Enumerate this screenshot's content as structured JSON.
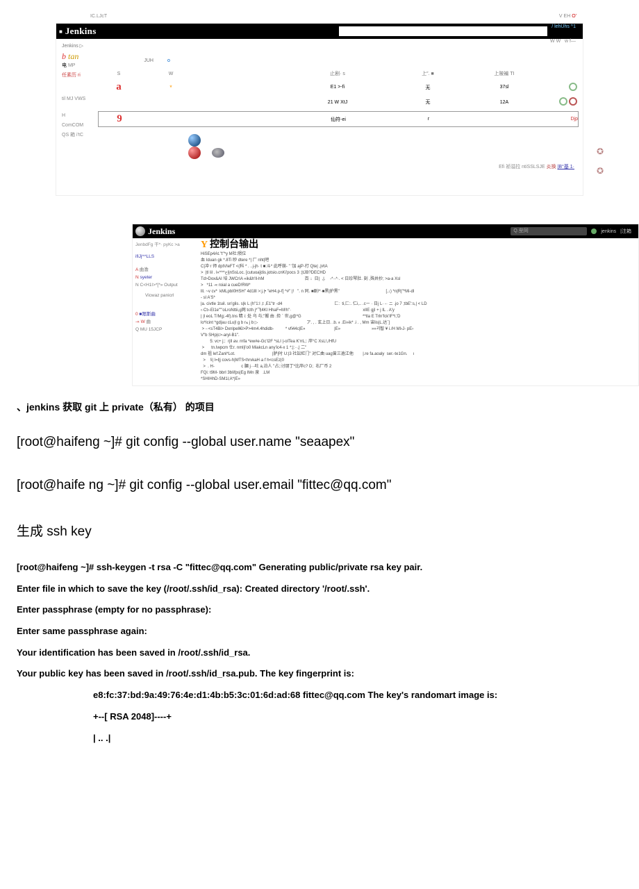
{
  "toprow": {
    "left": "IC.LJcT",
    "right_a": "V EH ",
    "right_b": "O'"
  },
  "dash": {
    "brand": "Jenkins",
    "login": "/ lehUhs\n^1",
    "scale": "W W   w f—",
    "crumb": "Jenkins  ▷",
    "side": {
      "tan_b": "b ",
      "tan_t": "tan",
      "l1_icon": "电",
      "l1": "MP",
      "l2_pre": "z",
      "l2": "任素历 ri",
      "sep": "",
      "q1": "til MJ VWS",
      "q2": "H ComCOM QS 箱 i'tC"
    },
    "tabs": {
      "jun": "JUH",
      "plus": "o"
    },
    "thead": {
      "s": "S",
      "w": "W",
      "a": "止剧· s",
      "b": "上″. ■",
      "c": "上陂褊 TI"
    },
    "rows": [
      {
        "s": "a",
        "w": "*",
        "n": "",
        "a": "E1 >-fi",
        "b": "无",
        "c": "37sl",
        "d": ""
      },
      {
        "s": "",
        "w": "",
        "n": "",
        "a": "21 W XtJ",
        "b": "无",
        "c": "12A",
        "d": ""
      },
      {
        "s": "9",
        "w": "",
        "n": "",
        "a": "仙符-ei",
        "b": "r",
        "c": "",
        "d": "Djp"
      }
    ],
    "footer": {
      "a": "Efi 祯溢拉  ntiSSLSJE ",
      "b": "炎换 ",
      "c": "|B°基 1·"
    }
  },
  "console": {
    "brand": "Jenkins",
    "search_ph": "Q.垒同",
    "user": "jenkins",
    "logout": "|注箱",
    "crumb": "JenbdFg 干*· pyKc  >a",
    "title_pre": "Y ",
    "title": "控制台输出",
    "side": {
      "l1": "ifiJj^^LLS",
      "l2_a": "A ",
      "l2_b": "曲澹",
      "l3_a": "N ",
      "l3_b": "syeter",
      "l4": "N C<H1I>*[*» Output",
      "l5": "Vicwaz panicrl",
      "l6_a": "0  ",
      "l6_b": "■限斯曲",
      "l7_a": "-« W",
      "l7_b": "      曲",
      "l8": "Q MU 15JCP"
    },
    "log": "HiSEp4At.\"t\"*y M社:陨位\n血 Iduan gk *.8Ti 眇 dtere *| 厂 nht|吧\nC|冲 r 师 dptVleFT <(科 * . ..j-jh· t ■:斗* 此呼崩- \" '加 ajP-打 Qte| ,|#tA\n>  |tl lil . l«*^^احjnSsLoc. [cutuoa]dis.jotsio.cnKi'pocs 3 :|tJB?DECHD\nTd>Dox&AI 培 JWCrIA «ik&h'll-hM                                   百 ↓  日|  ,|.    -*·-*·. < 日珍琴肚. 刻 ,殊井抄; >a-a Xsl\n>   *11 -« roial a cueD!RW*\nlll. ~v cv*  kMLpbI0HSH\" 4d1lll >:j.|• \"eH4.p-f[ ^#\" |!   \". n 同. ■剧!*·■黑|护黑\"                                        [,↓) *n|R|\"*Mi-dI\n- sl A'S*\n|a. civtle 1tuil. sn'glis. s|k L (h\"1:l ,t ,E1\"tr -d4                                             匚:  ti,匚:. 仁i,.. .cー · 日j L· -· ニ .jo 7 ;tbE':s,| < LD\n‹·Ct›-El1e\"'\"oLroNttii,g网 tcth j*飞4Kl HhaF=M!h\"·                                                              xlIE gjI + j IL . A'y\n| |l eoL T/Mg;-4f).tns 精 i: 处 乌 与;\"搬 由 .俭 ` 世,g@*G                                                     **tla E Trln'fck'IF*l,'D\nlo*Icint *gd|au cLu|l g b rﺔ j b ▷                                          ア. , . 玄上日. .b. ء .Ei»ik* .i . , Mm 宙lis|L.达`]\n > -·<sT4Bi> Dxnlpell€i>P>4m4.4hdidb-          * vfi44c|E»                         |E»                           »»괴智 ¥ i./H MI›J- pE›\nV\"b SHp|c>-aryl-B1\".\n        5: vc+ j;:  rjll av. rnfa *ew#e-Gc'l2F *sLI |-oITea K'rrL;: 岸°C XsL!,/HfU\n >      tn.Iwpcm 仕r. nml|i'o0 MiakcLn any'ic4-x 1 *;|:··,| 二\"\ndm 祖 lef:Zanl*Lot.                                |胪|吋 U:|3 社訟紅门\" 对仁曲 uag曾三逾江他        |.re fa.aoaly  ser.-te1Gn.     ı\n  >    !i| l=l|j covs-h|MTS<hrvkaH·a f h<csEz|0\n  >  . H-                       c 膕 j··-吐 a,泊人 \"占;:讨朋丁*比岸c? D;  右厂币 2\nFQi: t9M- bbrl 3bIifps|Eg IMn 泉   .LM\n*SHIHhD-SM1i;A*|E»"
  },
  "text": {
    "t1": "、jenkins 获取 git 上 private（私有） 的项目",
    "cmd1": "[root@haifeng  ~]# git config --global user.name \"seaapex\"",
    "cmd2": "[root@haife ng ~]# git config --global user.email \"fittec@qq.com\"",
    "h1": "生成 ssh key",
    "k1": "[root@haifeng ~]# ssh-keygen -t rsa -C \"fittec@qq.com\" Generating public/private rsa key pair.",
    "k2": "Enter file in which to save the key (/root/.ssh/id_rsa): Created directory '/root/.ssh'.",
    "k3": "Enter passphrase (empty for no passphrase):",
    "k4": "Enter same passphrase again:",
    "k5": "Your identification has been saved in /root/.ssh/id_rsa.",
    "k6": "Your public key has been saved in /root/.ssh/id_rsa.pub. The key fingerprint is:",
    "k7": "e8:fc:37:bd:9a:49:76:4e:d1:4b:b5:3c:01:6d:ad:68 fittec@qq.com The key's randomart image is:",
    "k8": "+--[ RSA 2048]----+",
    "k9": "| .. .|"
  }
}
